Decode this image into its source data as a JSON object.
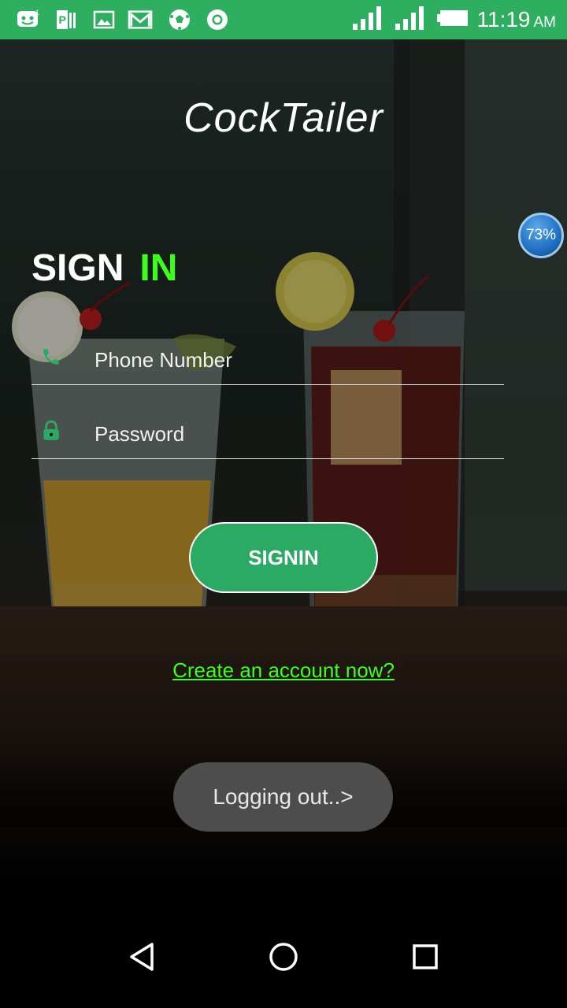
{
  "status_bar": {
    "time": "11:19",
    "ampm": "AM",
    "notification_icons": [
      "messenger-icon",
      "pdf-reader-icon",
      "gallery-icon",
      "gmail-icon",
      "soccer-ball-icon",
      "chrome-icon"
    ],
    "signal_icons": [
      "signal-sim1-icon",
      "signal-sim2-icon",
      "battery-icon"
    ],
    "color": "#2eae5f"
  },
  "app": {
    "title": "CockTailer"
  },
  "battery_overlay": {
    "percent": "73%"
  },
  "signin": {
    "heading_word1": "SIGN",
    "heading_word2": "IN",
    "accent_color": "#3cff1e",
    "phone_placeholder": "Phone Number",
    "password_placeholder": "Password",
    "button_label": "SIGNIN",
    "button_color": "#2aaa62",
    "create_account_link": "Create an account now?"
  },
  "toast": {
    "message": "Logging out..>"
  },
  "navigation_bar": {
    "buttons": [
      "back-icon",
      "home-icon",
      "recents-icon"
    ]
  }
}
